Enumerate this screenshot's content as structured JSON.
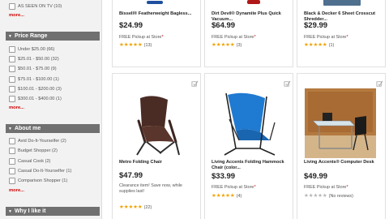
{
  "sidebar": {
    "brand_items": [
      {
        "label": "AS SEEN ON TV (10)"
      }
    ],
    "brand_more": "more...",
    "price_range": {
      "title": "Price Range",
      "items": [
        {
          "label": "Under $25.00 (66)"
        },
        {
          "label": "$25.01 - $50.00 (32)"
        },
        {
          "label": "$50.01 - $75.00 (9)"
        },
        {
          "label": "$75.01 - $100.00 (1)"
        },
        {
          "label": "$100.01 - $200.00 (3)"
        },
        {
          "label": "$300.01 - $400.00 (1)"
        }
      ],
      "more": "more..."
    },
    "about_me": {
      "title": "About me",
      "items": [
        {
          "label": "Avid Do-It-Yourselfer (2)"
        },
        {
          "label": "Budget Shopper (2)"
        },
        {
          "label": "Casual Cook (2)"
        },
        {
          "label": "Casual Do-It-Yourselfer (1)"
        },
        {
          "label": "Comparison Shopper (1)"
        }
      ],
      "more": "more..."
    },
    "why_i_like_it": {
      "title": "Why I like it"
    }
  },
  "products": [
    {
      "name": "Bissell® Featherweight Bagless...",
      "price": "$24.99",
      "pickup": "FREE Pickup at Store",
      "rating": 5,
      "reviews": "(13)"
    },
    {
      "name": "Dirt Devil® Dynamite Plus Quick Vacuum...",
      "price": "$64.99",
      "pickup": "FREE Pickup at Store",
      "rating": 5,
      "reviews": "(3)"
    },
    {
      "name": "Black & Decker 6 Sheet Crosscut Shredder...",
      "price": "$29.99",
      "pickup": "FREE Pickup at Store",
      "rating": 5,
      "reviews": "(1)"
    },
    {
      "name": "Metro Folding Chair",
      "price": "$47.99",
      "note": "Clearance item! Save now, while supplies last!",
      "rating": 5,
      "reviews": "(22)"
    },
    {
      "name": "Living Accents Folding Hammock Chair (color...",
      "price": "$33.99",
      "pickup": "FREE Pickup at Store",
      "rating": 5,
      "reviews": "(4)"
    },
    {
      "name": "Living Accents® Computer Desk",
      "price": "$49.99",
      "pickup": "FREE Pickup at Store",
      "rating": 0,
      "reviews": "(No reviews)"
    }
  ],
  "pickup_mark": "*",
  "colors": {
    "sidebar_header": "#707070",
    "more_link": "#cc0000",
    "star": "#f2a300"
  }
}
